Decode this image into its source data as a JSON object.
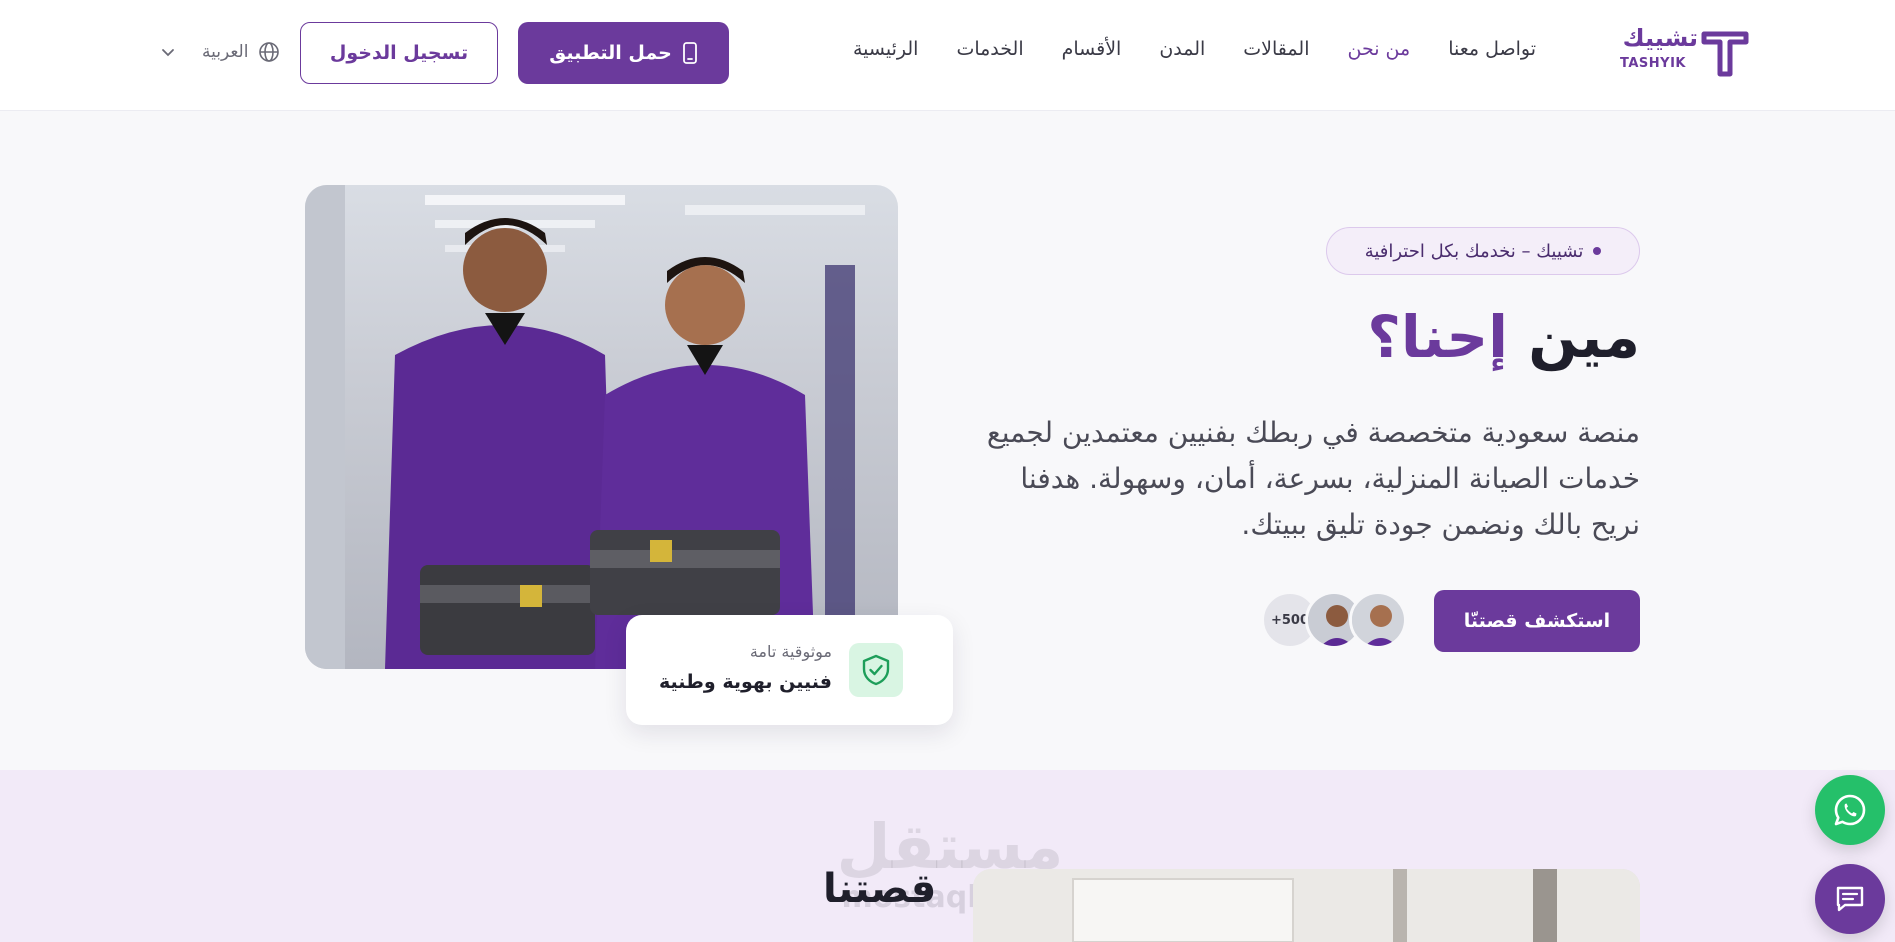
{
  "brand": {
    "name_ar": "تشييك",
    "name_en": "TASHYIK",
    "accent_color": "#6b3a9c",
    "whatsapp_color": "#25c06a"
  },
  "nav": {
    "items": [
      {
        "label": "الرئيسية",
        "active": false
      },
      {
        "label": "الخدمات",
        "active": false
      },
      {
        "label": "الأقسام",
        "active": false
      },
      {
        "label": "المدن",
        "active": false
      },
      {
        "label": "المقالات",
        "active": false
      },
      {
        "label": "من نحن",
        "active": true
      },
      {
        "label": "تواصل معنا",
        "active": false
      }
    ],
    "download_app_label": "حمل التطبيق",
    "login_label": "تسجيل الدخول",
    "language_label": "العربية"
  },
  "hero": {
    "pill_label": "تشييك – نخدمك بكل احترافية",
    "title_plain": "مين",
    "title_accent": "إحنا؟",
    "description": "منصة سعودية متخصصة في ربطك بفنيين معتمدين لجميع خدمات الصيانة المنزلية، بسرعة، أمان، وسهولة. هدفنا نريح بالك ونضمن جودة تليق ببيتك.",
    "cta_label": "استكشف قصتنّا",
    "avatars_count_label": "+500",
    "trust_badge": {
      "title": "موثوقية تامة",
      "subtitle": "فنيين بهوية وطنية"
    }
  },
  "story": {
    "title": "قصتنا",
    "watermark": "مستقل",
    "watermark_sub": "mostaql.com"
  },
  "icons": {
    "phone": "phone-icon",
    "globe": "globe-icon",
    "chevron": "chevron-down-icon",
    "shield": "shield-check-icon",
    "whatsapp": "whatsapp-icon",
    "chat": "chat-icon"
  }
}
